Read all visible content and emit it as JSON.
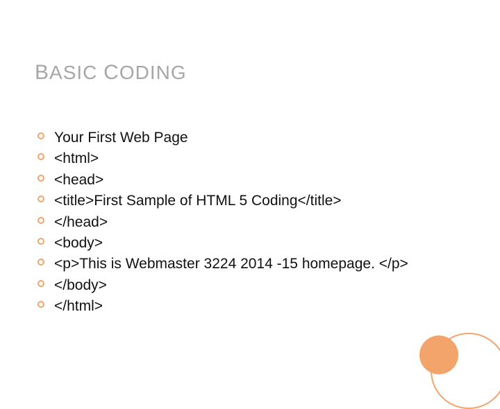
{
  "title": {
    "word1_cap": "B",
    "word1_rest": "ASIC",
    "space": " ",
    "word2_cap": "C",
    "word2_rest": "ODING"
  },
  "items": [
    "Your First Web Page",
    "<html>",
    "<head>",
    "<title>First Sample of HTML 5 Coding</title>",
    "</head>",
    "<body>",
    "<p>This is Webmaster 3224 2014 -15 homepage. </p>",
    "</body>",
    "</html>"
  ]
}
